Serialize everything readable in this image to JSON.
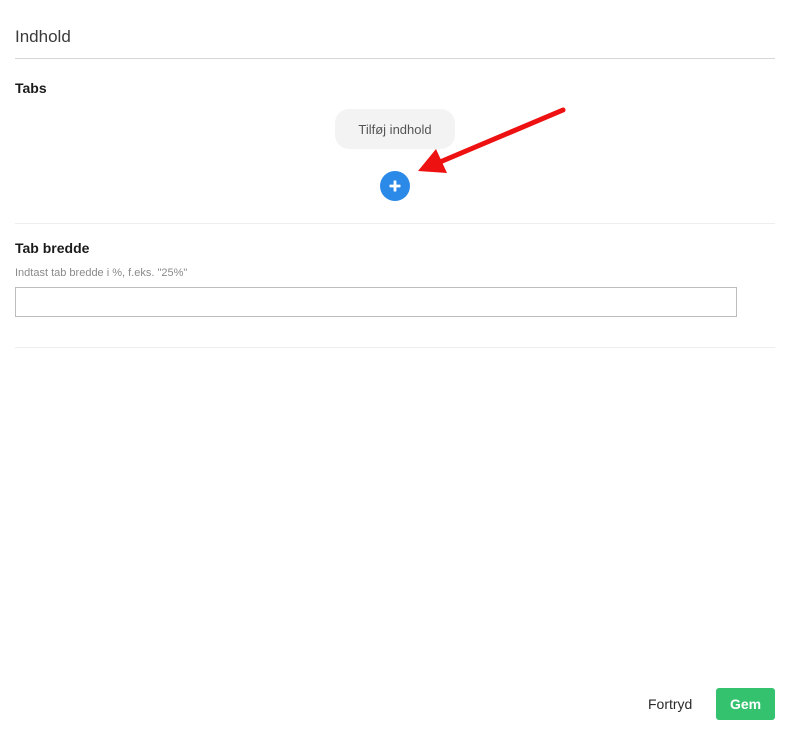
{
  "panel": {
    "title": "Indhold"
  },
  "tabs_section": {
    "label": "Tabs",
    "add_content_label": "Tilføj indhold",
    "add_icon": "plus-icon"
  },
  "annotation": {
    "arrow_color": "#ee1111"
  },
  "tab_width_section": {
    "label": "Tab bredde",
    "hint": "Indtast tab bredde i %, f.eks. \"25%\"",
    "input_value": "",
    "input_placeholder": ""
  },
  "footer": {
    "cancel_label": "Fortryd",
    "save_label": "Gem"
  },
  "colors": {
    "accent_blue": "#2b8ae8",
    "save_green": "#35c26f"
  }
}
